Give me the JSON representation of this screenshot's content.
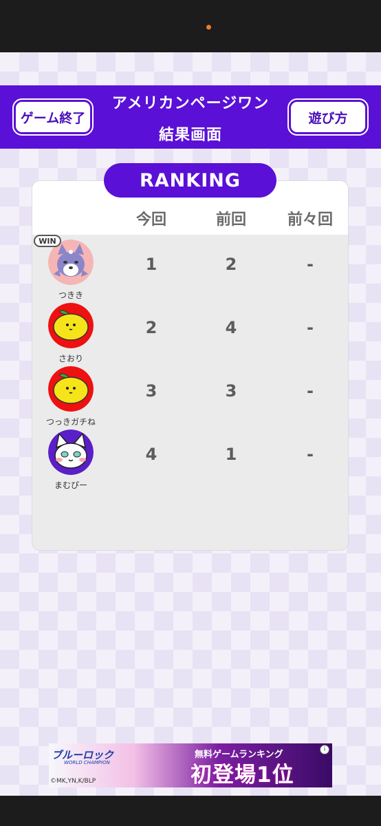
{
  "header": {
    "end_button": "ゲーム終了",
    "title_line1": "アメリカンページワン",
    "title_line2": "結果画面",
    "howto_button": "遊び方"
  },
  "ranking": {
    "title": "RANKING",
    "columns": [
      "今回",
      "前回",
      "前々回"
    ],
    "win_badge": "WIN",
    "players": [
      {
        "name": "つきき",
        "avatar": "wolf-avatar",
        "current": "1",
        "previous": "2",
        "before_previous": "-"
      },
      {
        "name": "さおり",
        "avatar": "lemon-avatar",
        "current": "2",
        "previous": "4",
        "before_previous": "-"
      },
      {
        "name": "つっきガチね",
        "avatar": "lemon-avatar",
        "current": "3",
        "previous": "3",
        "before_previous": "-"
      },
      {
        "name": "まむぴー",
        "avatar": "cat-avatar",
        "current": "4",
        "previous": "1",
        "before_previous": "-"
      }
    ]
  },
  "ad": {
    "brand": "ブルーロック",
    "brand_sub": "WORLD CHAMPION",
    "copyright": "©MK,YN,K/BLP",
    "tagline": "無料ゲームランキング",
    "headline": "初登場1位",
    "info_icon": "i"
  },
  "colors": {
    "accent": "#5a10d6",
    "panel_bg": "#ebebeb"
  }
}
